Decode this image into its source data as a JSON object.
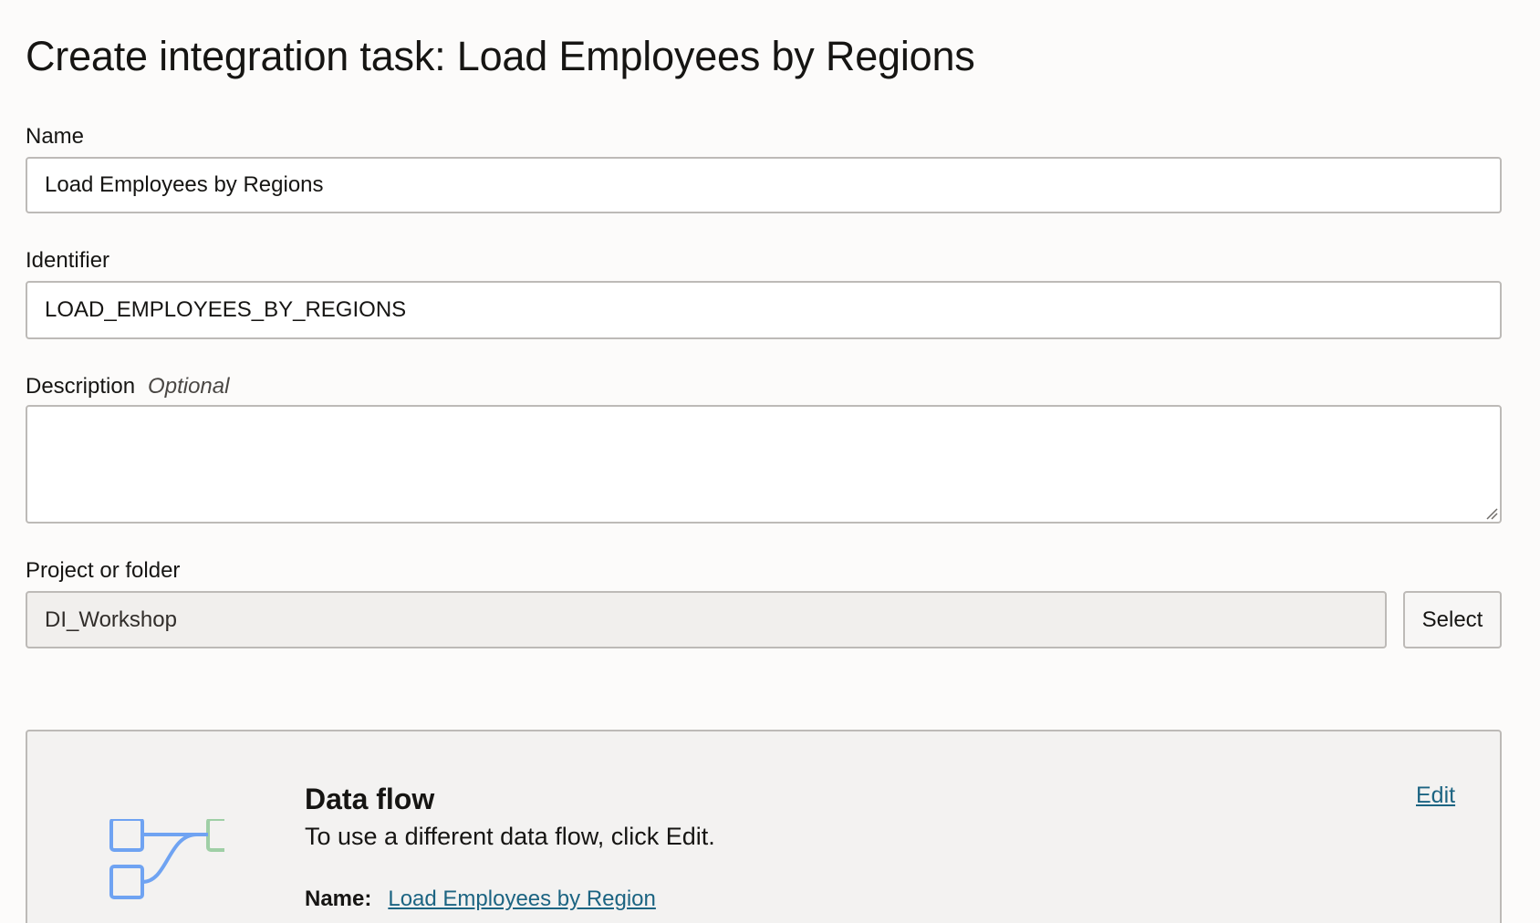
{
  "page": {
    "title": "Create integration task: Load Employees by Regions"
  },
  "form": {
    "name": {
      "label": "Name",
      "value": "Load Employees by Regions"
    },
    "identifier": {
      "label": "Identifier",
      "value": "LOAD_EMPLOYEES_BY_REGIONS"
    },
    "description": {
      "label": "Description",
      "optional_label": "Optional",
      "value": ""
    },
    "project": {
      "label": "Project or folder",
      "value": "DI_Workshop",
      "select_label": "Select"
    }
  },
  "data_flow": {
    "title": "Data flow",
    "description": "To use a different data flow, click Edit.",
    "edit_label": "Edit",
    "name_key": "Name:",
    "name_value": "Load Employees by Region",
    "icon": "data-flow-icon",
    "colors": {
      "source_nodes": "#6fa3f2",
      "target_node": "#9fcfa6",
      "link": "#1c6482"
    }
  }
}
